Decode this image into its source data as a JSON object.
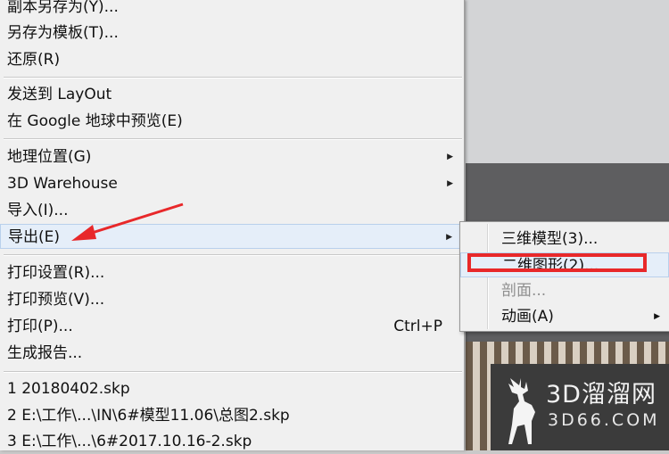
{
  "menu": {
    "items": [
      {
        "label": "副本另存为(Y)..."
      },
      {
        "label": "另存为模板(T)..."
      },
      {
        "label": "还原(R)"
      },
      {
        "label": "发送到 LayOut"
      },
      {
        "label": "在 Google 地球中预览(E)"
      },
      {
        "label": "地理位置(G)"
      },
      {
        "label": "3D Warehouse"
      },
      {
        "label": "导入(I)..."
      },
      {
        "label": "导出(E)"
      },
      {
        "label": "打印设置(R)..."
      },
      {
        "label": "打印预览(V)..."
      },
      {
        "label": "打印(P)...",
        "shortcut": "Ctrl+P"
      },
      {
        "label": "生成报告..."
      },
      {
        "label": "1 20180402.skp"
      },
      {
        "label": "2 E:\\工作\\...\\IN\\6#模型11.06\\总图2.skp"
      },
      {
        "label": "3 E:\\工作\\...\\6#2017.10.16-2.skp"
      }
    ]
  },
  "submenu": {
    "items": [
      {
        "label": "三维模型(3)..."
      },
      {
        "label": "二维图形(2)..."
      },
      {
        "label": "剖面..."
      },
      {
        "label": "动画(A)"
      }
    ]
  },
  "watermark": {
    "title": "3D溜溜网",
    "domain": "3D66.COM"
  },
  "colors": {
    "annotation": "#e8282a",
    "highlight": "#e5eef9"
  }
}
